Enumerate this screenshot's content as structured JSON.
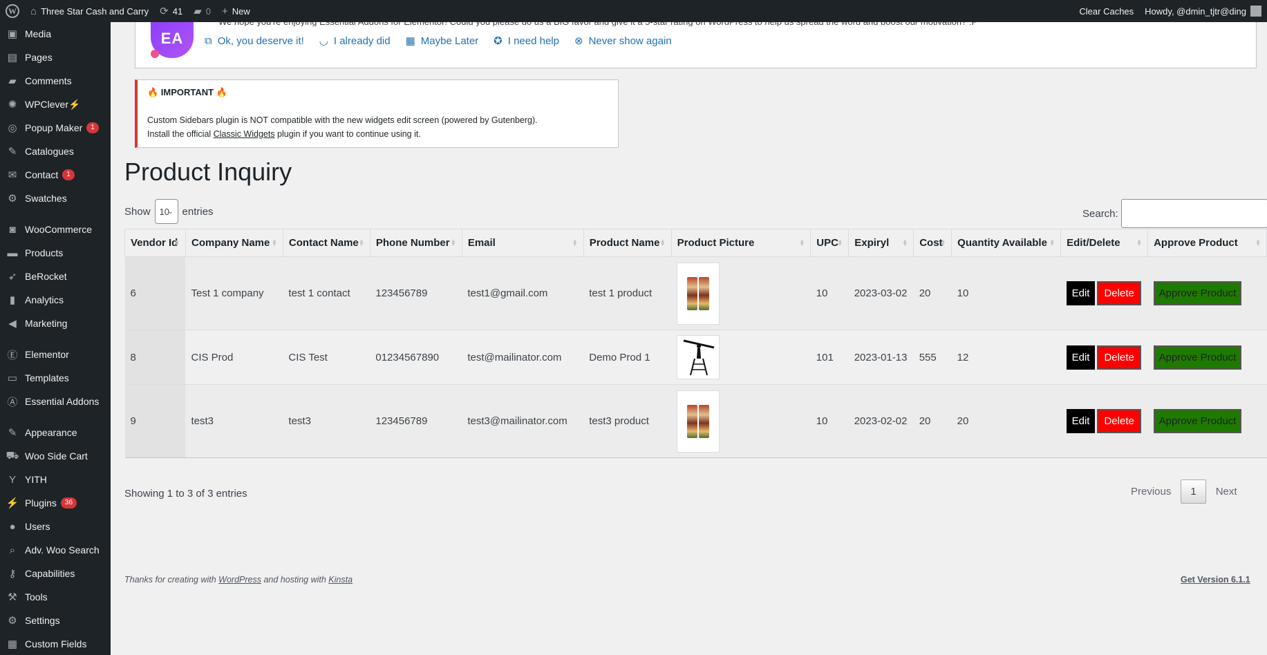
{
  "adminbar": {
    "site_name": "Three Star Cash and Carry",
    "updates_count": "41",
    "comments_count": "0",
    "new_label": "New",
    "clear_caches": "Clear Caches",
    "howdy": "Howdy, @dmin_tjtr@ding"
  },
  "sidebar": {
    "items": [
      {
        "label": "Media",
        "icon": "media-icon"
      },
      {
        "label": "Pages",
        "icon": "pages-icon"
      },
      {
        "label": "Comments",
        "icon": "comments-icon"
      },
      {
        "label": "WPClever⚡",
        "icon": "wpclever-icon"
      },
      {
        "label": "Popup Maker",
        "icon": "popup-maker-icon",
        "badge": "1"
      },
      {
        "label": "Catalogues",
        "icon": "pin-icon"
      },
      {
        "label": "Contact",
        "icon": "mail-icon",
        "badge": "1"
      },
      {
        "label": "Swatches",
        "icon": "gear-icon"
      },
      {
        "label": "WooCommerce",
        "icon": "woocommerce-icon"
      },
      {
        "label": "Products",
        "icon": "products-icon"
      },
      {
        "label": "BeRocket",
        "icon": "rocket-icon"
      },
      {
        "label": "Analytics",
        "icon": "analytics-icon"
      },
      {
        "label": "Marketing",
        "icon": "megaphone-icon"
      },
      {
        "label": "Elementor",
        "icon": "elementor-icon"
      },
      {
        "label": "Templates",
        "icon": "folder-icon"
      },
      {
        "label": "Essential Addons",
        "icon": "essential-addons-icon"
      },
      {
        "label": "Appearance",
        "icon": "brush-icon"
      },
      {
        "label": "Woo Side Cart",
        "icon": "cart-icon"
      },
      {
        "label": "YITH",
        "icon": "yith-icon"
      },
      {
        "label": "Plugins",
        "icon": "plugin-icon",
        "badge": "36"
      },
      {
        "label": "Users",
        "icon": "user-icon"
      },
      {
        "label": "Adv. Woo Search",
        "icon": "search-icon"
      },
      {
        "label": "Capabilities",
        "icon": "key-icon"
      },
      {
        "label": "Tools",
        "icon": "wrench-icon"
      },
      {
        "label": "Settings",
        "icon": "settings-icon"
      },
      {
        "label": "Custom Fields",
        "icon": "custom-fields-icon"
      }
    ]
  },
  "ea_notice": {
    "cut_text": "We hope you're enjoying Essential Addons for Elementor! Could you please do us a BIG favor and give it a 5-star rating on WordPress to help us spread the word and boost our motivation? :P",
    "links": [
      {
        "label": "Ok, you deserve it!",
        "icon": "external-link-icon"
      },
      {
        "label": "I already did",
        "icon": "smile-icon"
      },
      {
        "label": "Maybe Later",
        "icon": "calendar-icon"
      },
      {
        "label": "I need help",
        "icon": "help-icon"
      },
      {
        "label": "Never show again",
        "icon": "dismiss-icon"
      }
    ]
  },
  "important": {
    "title": "🔥 IMPORTANT 🔥",
    "line1": "Custom Sidebars plugin is NOT compatible with the new widgets edit screen (powered by Gutenberg).",
    "line2_pre": "Install the official ",
    "line2_link": "Classic Widgets",
    "line2_post": " plugin if you want to continue using it."
  },
  "page_title": "Product Inquiry",
  "table_controls": {
    "show": "Show",
    "length_value": "10",
    "entries": "entries",
    "search_label": "Search:",
    "search_value": ""
  },
  "table": {
    "headers": [
      "Vendor Id",
      "Company Name",
      "Contact Name",
      "Phone Number",
      "Email",
      "Product Name",
      "Product Picture",
      "UPC",
      "Expiryl",
      "Cost",
      "Quantity Available",
      "Edit/Delete",
      "Approve Product"
    ],
    "rows": [
      {
        "vendor_id": "6",
        "company": "Test 1 company",
        "contact": "test 1 contact",
        "phone": "123456789",
        "email": "test1@gmail.com",
        "product": "test 1 product",
        "picture": "product-package",
        "upc": "10",
        "expiry": "2023-03-02",
        "cost": "20",
        "qty": "10"
      },
      {
        "vendor_id": "8",
        "company": "CIS Prod",
        "contact": "CIS Test",
        "phone": "01234567890",
        "email": "test@mailinator.com",
        "product": "Demo Prod 1",
        "picture": "ladder-worker",
        "upc": "101",
        "expiry": "2023-01-13",
        "cost": "555",
        "qty": "12"
      },
      {
        "vendor_id": "9",
        "company": "test3",
        "contact": "test3",
        "phone": "123456789",
        "email": "test3@mailinator.com",
        "product": "test3 product",
        "picture": "product-package",
        "upc": "10",
        "expiry": "2023-02-02",
        "cost": "20",
        "qty": "20"
      }
    ],
    "edit_label": "Edit",
    "delete_label": "Delete",
    "approve_label": "Approve Product"
  },
  "table_footer": {
    "info": "Showing 1 to 3 of 3 entries",
    "previous": "Previous",
    "page": "1",
    "next": "Next"
  },
  "footer": {
    "thanks_pre": "Thanks for creating with ",
    "wordpress": "WordPress",
    "thanks_mid": " and hosting with ",
    "kinsta": "Kinsta",
    "version": "Get Version 6.1.1"
  },
  "colors": {
    "adminbar_bg": "#1d2327",
    "link": "#2271b1",
    "delete_red": "#ff0000",
    "approve_green": "#1f7a00",
    "badge_red": "#d63638"
  }
}
